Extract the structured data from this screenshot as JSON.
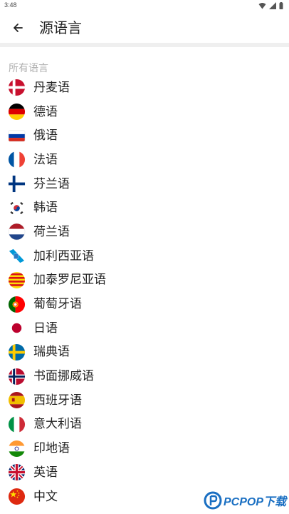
{
  "status": {
    "time": "3:48"
  },
  "header": {
    "title": "源语言"
  },
  "section": {
    "label": "所有语言"
  },
  "languages": [
    {
      "label": "丹麦语",
      "flag": "denmark"
    },
    {
      "label": "德语",
      "flag": "germany"
    },
    {
      "label": "俄语",
      "flag": "russia"
    },
    {
      "label": "法语",
      "flag": "france"
    },
    {
      "label": "芬兰语",
      "flag": "finland"
    },
    {
      "label": "韩语",
      "flag": "korea"
    },
    {
      "label": "荷兰语",
      "flag": "netherlands"
    },
    {
      "label": "加利西亚语",
      "flag": "galicia"
    },
    {
      "label": "加泰罗尼亚语",
      "flag": "catalonia"
    },
    {
      "label": "葡萄牙语",
      "flag": "portugal"
    },
    {
      "label": "日语",
      "flag": "japan"
    },
    {
      "label": "瑞典语",
      "flag": "sweden"
    },
    {
      "label": "书面挪威语",
      "flag": "norway"
    },
    {
      "label": "西班牙语",
      "flag": "spain"
    },
    {
      "label": "意大利语",
      "flag": "italy"
    },
    {
      "label": "印地语",
      "flag": "india"
    },
    {
      "label": "英语",
      "flag": "uk"
    },
    {
      "label": "中文",
      "flag": "china"
    }
  ],
  "watermark": {
    "text": "PCPOP下载"
  }
}
